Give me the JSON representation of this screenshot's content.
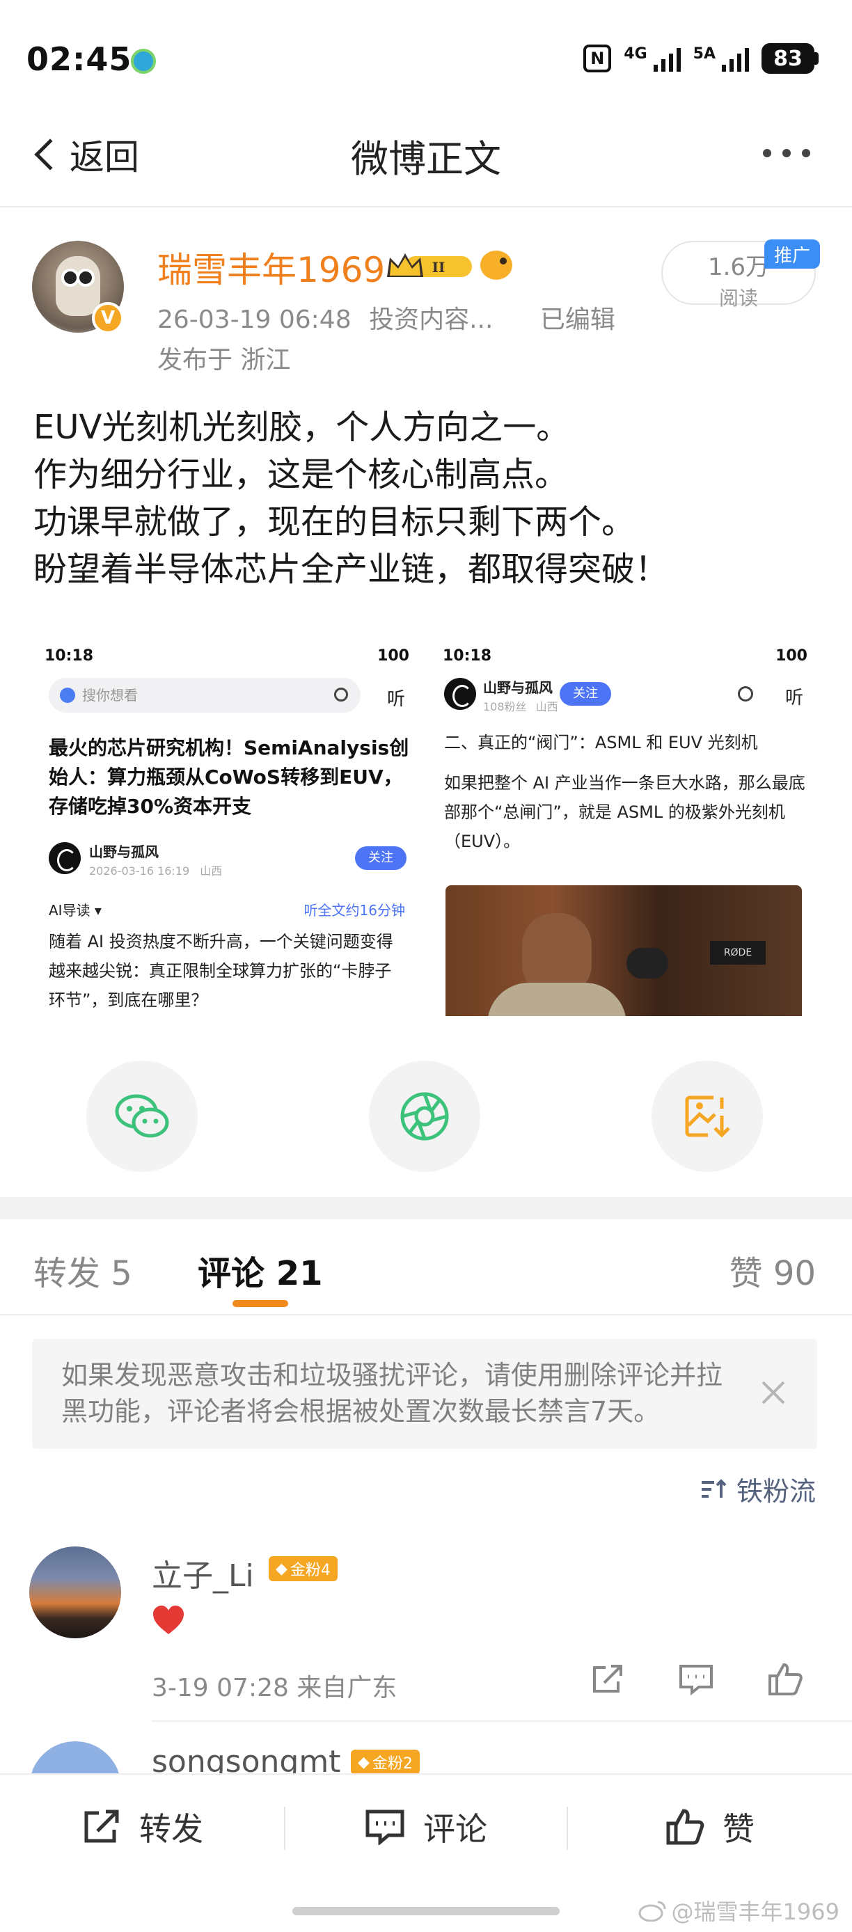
{
  "status_bar": {
    "time": "02:45",
    "network1": "4G",
    "network2": "5A",
    "battery": "83"
  },
  "nav": {
    "back_label": "返回",
    "title": "微博正文"
  },
  "post": {
    "author": {
      "name": "瑞雪丰年1969",
      "verified_badge": "V",
      "level_badge": "II"
    },
    "timestamp": "26-03-19 06:48",
    "category": "投资内容...",
    "edited": "已编辑",
    "location": "发布于 浙江",
    "reads": {
      "count": "1.6万",
      "label": "阅读",
      "promo": "推广"
    },
    "text_lines": [
      "EUV光刻机光刻胶，个人方向之一。",
      "作为细分行业，这是个核心制高点。",
      "功课早就做了，现在的目标只剩下两个。",
      "盼望着半导体芯片全产业链，都取得突破！"
    ],
    "image1": {
      "time": "10:18",
      "battery": "100",
      "search_placeholder": "搜你想看",
      "listen": "听",
      "headline": "最火的芯片研究机构！SemiAnalysis创始人：算力瓶颈从CoWoS转移到EUV，存储吃掉30%资本开支",
      "author": "山野与孤风",
      "date": "2026-03-16 16:19",
      "region": "山西",
      "follow": "关注",
      "guide": "AI导读 ▾",
      "listen_full": "听全文约16分钟",
      "body": "随着 AI 投资热度不断升高，一个关键问题变得越来越尖锐：真正限制全球算力扩张的“卡脖子环节”，到底在哪里？"
    },
    "image2": {
      "time": "10:18",
      "battery": "100",
      "author": "山野与孤风",
      "followers": "108粉丝",
      "region": "山西",
      "follow": "关注",
      "listen": "听",
      "heading": "二、真正的“阀门”：ASML 和 EUV 光刻机",
      "body": "如果把整个 AI 产业当作一条巨大水路，那么最底部那个“总闸门”，就是 ASML 的极紫外光刻机（EUV）。",
      "photo_text": "RØDE"
    }
  },
  "share": {
    "icons": [
      "wechat-icon",
      "moments-icon",
      "save-image-icon"
    ]
  },
  "tabs": {
    "repost": "转发 5",
    "comments": "评论 21",
    "likes": "赞 90"
  },
  "notice": {
    "text": "如果发现恶意攻击和垃圾骚扰评论，请使用删除评论并拉黑功能，评论者将会根据被处置次数最长禁言7天。"
  },
  "sort": {
    "label": "铁粉流"
  },
  "comments": [
    {
      "name": "立子_Li",
      "badge": "金粉4",
      "content": "❤",
      "meta": "3-19 07:28 来自广东"
    },
    {
      "name": "songsongmt",
      "badge": "金粉2"
    }
  ],
  "bottom_bar": {
    "repost": "转发",
    "comment": "评论",
    "like": "赞"
  },
  "watermark": "@瑞雪丰年1969",
  "colors": {
    "accent_orange": "#f08a1f",
    "author_orange": "#f07f1d",
    "fan_badge": "#f5a623",
    "promo_blue": "#3a8ef6",
    "wechat_green": "#3cc27a"
  }
}
